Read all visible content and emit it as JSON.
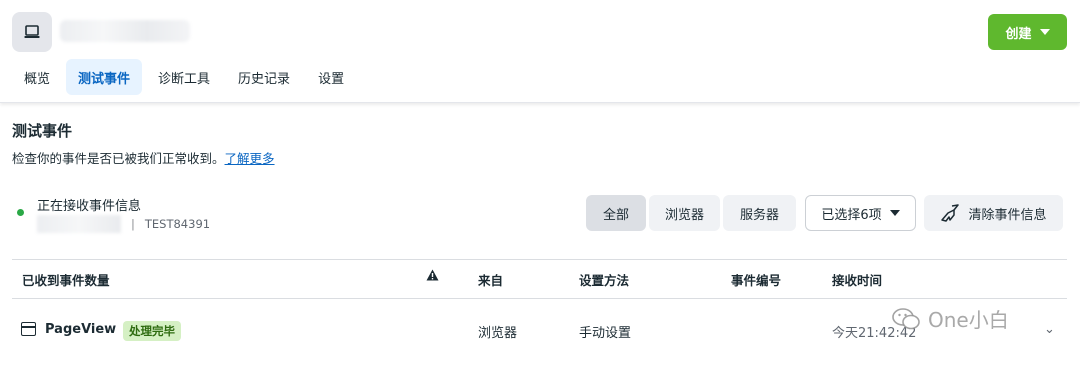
{
  "header": {
    "app_icon": "laptop-icon",
    "create_label": "创建"
  },
  "tabs": [
    {
      "label": "概览",
      "active": false
    },
    {
      "label": "测试事件",
      "active": true
    },
    {
      "label": "诊断工具",
      "active": false
    },
    {
      "label": "历史记录",
      "active": false
    },
    {
      "label": "设置",
      "active": false
    }
  ],
  "section": {
    "title": "测试事件",
    "description": "检查你的事件是否已被我们正常收到。",
    "learn_more": "了解更多"
  },
  "status": {
    "title": "正在接收事件信息",
    "separator": "|",
    "test_code": "TEST84391",
    "dot_color": "#2aa846"
  },
  "filters": {
    "all": "全部",
    "browser": "浏览器",
    "server": "服务器",
    "selected": "已选择6项",
    "clear": "清除事件信息"
  },
  "table": {
    "headers": {
      "count": "已收到事件数量",
      "warning_icon": "warning-icon",
      "from": "来自",
      "method": "设置方法",
      "event_id": "事件编号",
      "time": "接收时间"
    },
    "rows": [
      {
        "icon": "page-icon",
        "name": "PageView",
        "status": "处理完毕",
        "from": "浏览器",
        "method": "手动设置",
        "event_id": "",
        "time": "今天21:42:42"
      }
    ]
  },
  "watermark": {
    "text": "One小白"
  },
  "colors": {
    "accent_green": "#5fb82e",
    "link_blue": "#0a66c2",
    "active_tab_bg": "#e7f3ff",
    "badge_bg": "#d5f0c4"
  }
}
